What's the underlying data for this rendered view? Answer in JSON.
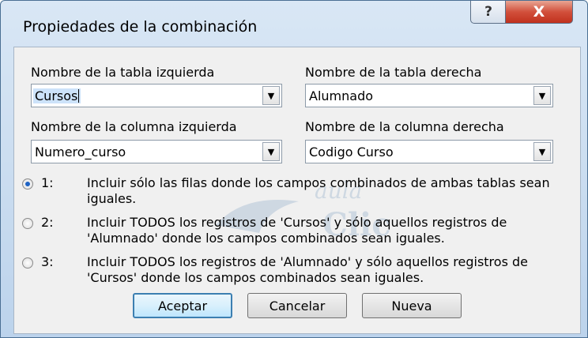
{
  "window": {
    "title": "Propiedades de la combinación",
    "help_glyph": "?",
    "close_glyph": "X"
  },
  "fields": {
    "left_table_label": "Nombre de la tabla izquierda",
    "left_table_value": "Cursos",
    "right_table_label": "Nombre de la tabla derecha",
    "right_table_value": "Alumnado",
    "left_column_label": "Nombre de la columna izquierda",
    "left_column_value": "Numero_curso",
    "right_column_label": "Nombre de la columna derecha",
    "right_column_value": "Codigo Curso",
    "dropdown_glyph": "▼"
  },
  "options": [
    {
      "number": "1:",
      "text_line1": "Incluir sólo las filas donde los campos combinados de ambas tablas sean",
      "text_line2": "iguales.",
      "checked": true
    },
    {
      "number": "2:",
      "text_line1": "Incluir TODOS los registros de 'Cursos' y sólo aquellos registros de",
      "text_line2": "'Alumnado' donde los campos combinados sean iguales.",
      "checked": false
    },
    {
      "number": "3:",
      "text_line1": "Incluir TODOS los registros de 'Alumnado' y sólo aquellos registros de",
      "text_line2": "'Cursos' donde los campos combinados sean iguales.",
      "checked": false
    }
  ],
  "buttons": {
    "accept": "Aceptar",
    "cancel": "Cancelar",
    "new": "Nueva"
  },
  "watermark": {
    "line1": "aula",
    "line2": "Clic"
  },
  "colors": {
    "selection": "#cde3fa",
    "radio_selected": "#1e63c4",
    "close_button": "#c0311d",
    "default_button_border": "#3c7fb1"
  }
}
